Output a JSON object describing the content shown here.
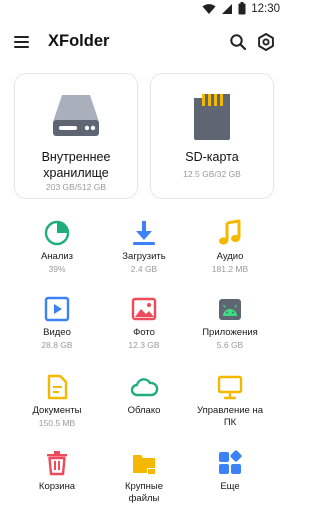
{
  "status_bar": {
    "time": "12:30",
    "icons": [
      "wifi-icon",
      "signal-icon",
      "battery-icon"
    ]
  },
  "app_bar": {
    "title": "XFolder",
    "icons": [
      "menu-icon",
      "search-icon",
      "settings-icon"
    ]
  },
  "storage": [
    {
      "title": "Внутреннее хранилище",
      "usage": "203 GB/512 GB",
      "icon": "hard-drive-icon"
    },
    {
      "title": "SD-карта",
      "usage": "12.5 GB/32 GB",
      "icon": "sd-card-icon"
    }
  ],
  "categories": [
    {
      "label": "Анализ",
      "sub": "39%",
      "icon": "analysis-icon",
      "color": "#1FAE7B"
    },
    {
      "label": "Загрузить",
      "sub": "2.4 GB",
      "icon": "download-icon",
      "color": "#3B82F6"
    },
    {
      "label": "Аудио",
      "sub": "181.2 MB",
      "icon": "music-icon",
      "color": "#F5B800"
    },
    {
      "label": "Видео",
      "sub": "28.8 GB",
      "icon": "video-icon",
      "color": "#3B82F6"
    },
    {
      "label": "Фото",
      "sub": "12.3 GB",
      "icon": "photo-icon",
      "color": "#EF4A5A"
    },
    {
      "label": "Приложения",
      "sub": "5.6 GB",
      "icon": "android-icon",
      "color": "#1FAE7B"
    },
    {
      "label": "Документы",
      "sub": "150.5 MB",
      "icon": "document-icon",
      "color": "#F5B800"
    },
    {
      "label": "Облако",
      "sub": "",
      "icon": "cloud-icon",
      "color": "#1FAE7B"
    },
    {
      "label": "Управление на ПК",
      "sub": "",
      "icon": "pc-icon",
      "color": "#F5B800"
    },
    {
      "label": "Корзина",
      "sub": "",
      "icon": "trash-icon",
      "color": "#EF4A5A"
    },
    {
      "label": "Крупные файлы",
      "sub": "",
      "icon": "folder-icon",
      "color": "#F5B800"
    },
    {
      "label": "Еще",
      "sub": "",
      "icon": "more-icon",
      "color": "#3B82F6"
    }
  ]
}
